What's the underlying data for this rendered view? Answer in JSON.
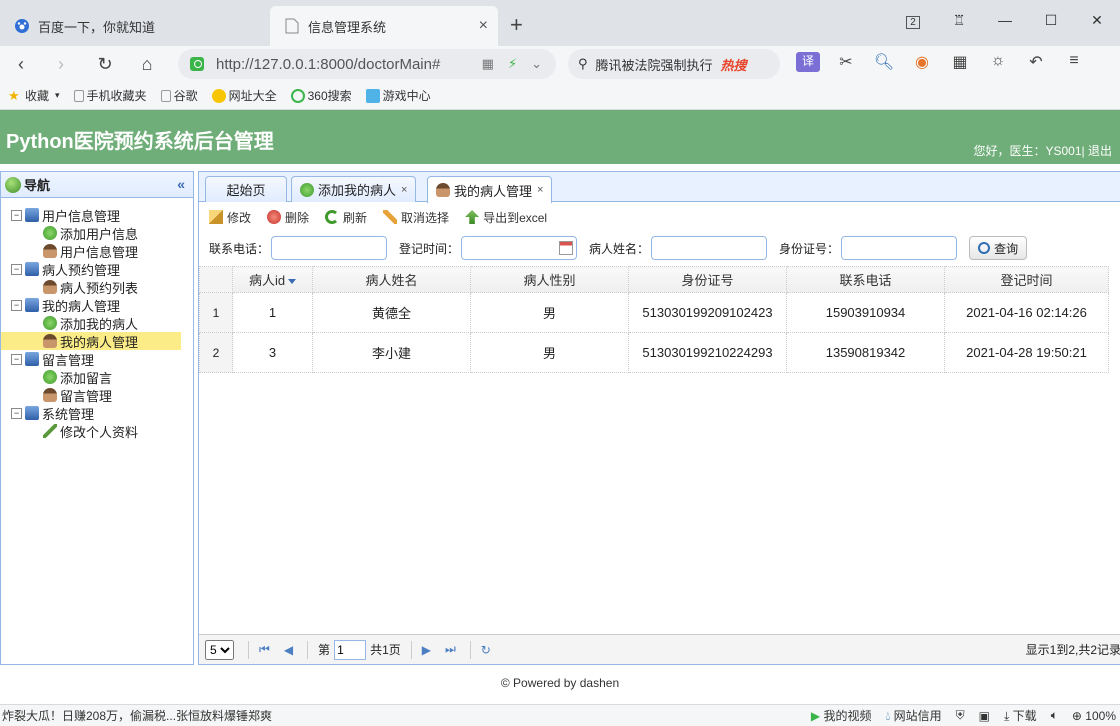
{
  "browser": {
    "tabs": [
      {
        "title": "百度一下，你就知道",
        "icon": "baidu-paw-icon"
      },
      {
        "title": "信息管理系统",
        "icon": "page-icon"
      }
    ],
    "url": "http://127.0.0.1:8000/doctorMain#",
    "search_text": "腾讯被法院强制执行",
    "search_hot": "热搜",
    "tab_count": "2",
    "bookmarks": [
      "收藏",
      "手机收藏夹",
      "谷歌",
      "网址大全",
      "360搜索",
      "游戏中心"
    ],
    "status_news": "炸裂大瓜！日赚208万，偷漏税...张恒放料爆锤郑爽",
    "status_items": [
      "我的视频",
      "网站信用",
      "下载",
      "100%"
    ]
  },
  "app": {
    "title": "Python医院预约系统后台管理",
    "greeting": "您好，医生：YS001",
    "logout": "退出"
  },
  "nav": {
    "title": "导航",
    "groups": [
      {
        "label": "用户信息管理",
        "items": [
          "添加用户信息",
          "用户信息管理"
        ]
      },
      {
        "label": "病人预约管理",
        "items": [
          "病人预约列表"
        ]
      },
      {
        "label": "我的病人管理",
        "items": [
          "添加我的病人",
          "我的病人管理"
        ]
      },
      {
        "label": "留言管理",
        "items": [
          "添加留言",
          "留言管理"
        ]
      },
      {
        "label": "系统管理",
        "items": [
          "修改个人资料"
        ]
      }
    ],
    "selected": "我的病人管理"
  },
  "tabs": [
    "起始页",
    "添加我的病人",
    "我的病人管理"
  ],
  "toolbar": {
    "edit": "修改",
    "delete": "删除",
    "refresh": "刷新",
    "cancel_select": "取消选择",
    "export": "导出到excel"
  },
  "search": {
    "phone_label": "联系电话：",
    "time_label": "登记时间：",
    "name_label": "病人姓名：",
    "id_label": "身份证号：",
    "button": "查询"
  },
  "table": {
    "columns": [
      "病人id",
      "病人姓名",
      "病人性别",
      "身份证号",
      "联系电话",
      "登记时间"
    ],
    "rows": [
      {
        "rn": "1",
        "id": "1",
        "name": "黄德全",
        "sex": "男",
        "idcard": "513030199209102423",
        "phone": "15903910934",
        "time": "2021-04-16 02:14:26"
      },
      {
        "rn": "2",
        "id": "3",
        "name": "李小建",
        "sex": "男",
        "idcard": "513030199210224293",
        "phone": "13590819342",
        "time": "2021-04-28 19:50:21"
      }
    ]
  },
  "pager": {
    "page_size": "5",
    "page_label": "第",
    "page_value": "1",
    "page_total": "共1页",
    "info": "显示1到2,共2记录"
  },
  "footer": "© Powered by dashen",
  "colors": {
    "header": "#6fad79",
    "border": "#95b8e7"
  }
}
